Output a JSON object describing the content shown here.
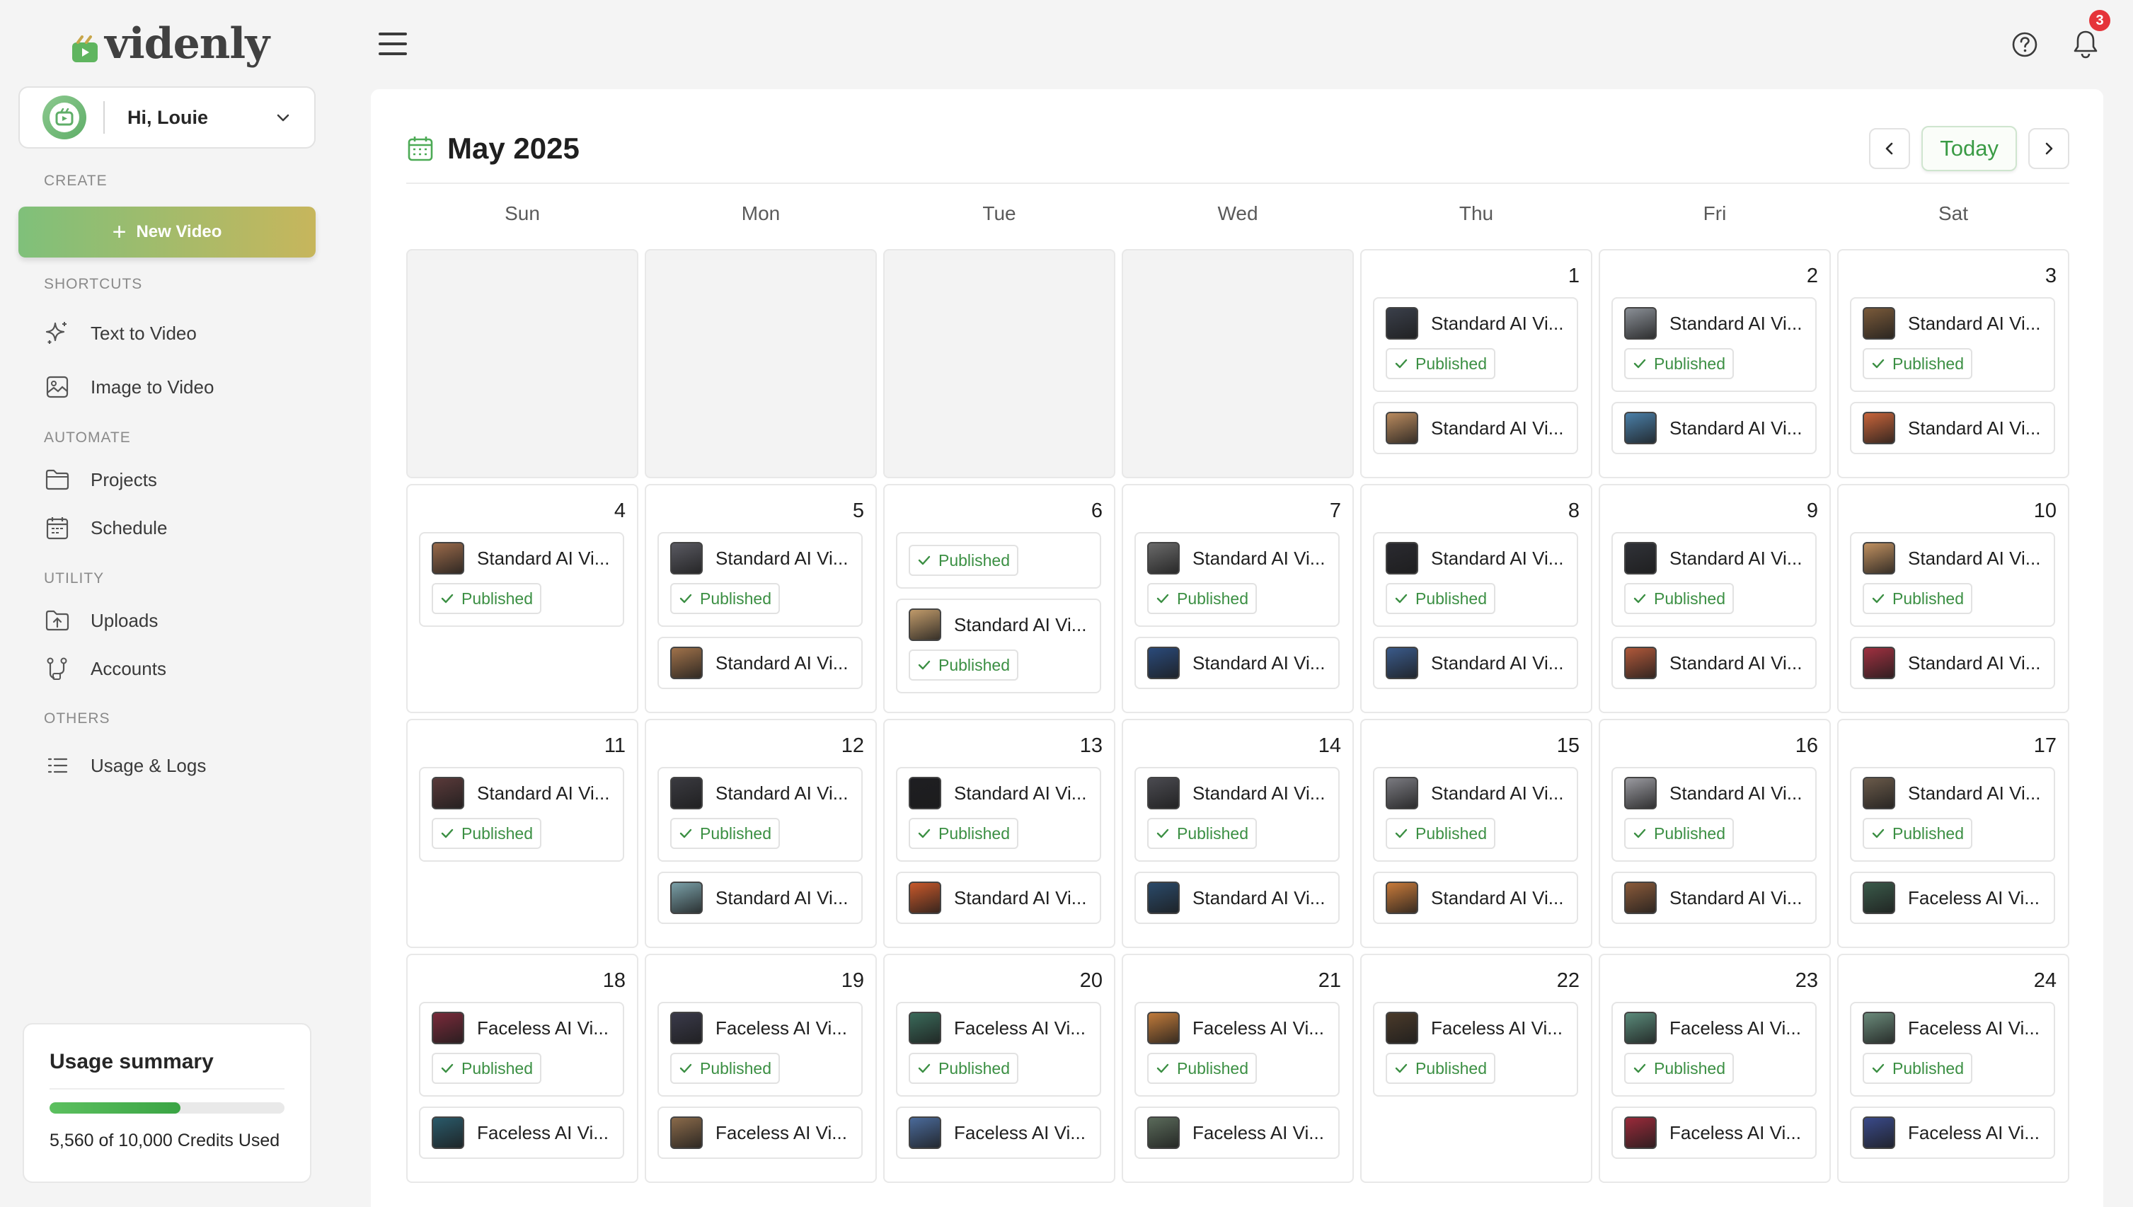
{
  "app": {
    "name": "videnly"
  },
  "user": {
    "greeting": "Hi, Louie"
  },
  "sidebar": {
    "sections": {
      "create": "CREATE",
      "shortcuts": "SHORTCUTS",
      "automate": "AUTOMATE",
      "utility": "UTILITY",
      "others": "OTHERS"
    },
    "new_video": "New Video",
    "items": [
      {
        "label": "Text to Video",
        "icon": "sparkle-icon"
      },
      {
        "label": "Image to Video",
        "icon": "image-icon"
      },
      {
        "label": "Projects",
        "icon": "folder-icon"
      },
      {
        "label": "Schedule",
        "icon": "calendar-icon"
      },
      {
        "label": "Uploads",
        "icon": "upload-icon"
      },
      {
        "label": "Accounts",
        "icon": "accounts-icon"
      },
      {
        "label": "Usage & Logs",
        "icon": "list-icon"
      }
    ]
  },
  "usage": {
    "title": "Usage summary",
    "used": 5560,
    "total": 10000,
    "text": "5,560 of 10,000 Credits Used"
  },
  "notifications": {
    "count": "3"
  },
  "calendar": {
    "title": "May 2025",
    "today_label": "Today",
    "weekdays": [
      "Sun",
      "Mon",
      "Tue",
      "Wed",
      "Thu",
      "Fri",
      "Sat"
    ],
    "published_label": "Published",
    "weeks": [
      [
        null,
        null,
        null,
        null,
        {
          "day": "1",
          "events": [
            {
              "title": "Standard AI Vi...",
              "status": "Published",
              "thumb": "#3a3f4a"
            },
            {
              "title": "Standard AI Vi...",
              "status": "",
              "thumb": "#b98a5e"
            }
          ]
        },
        {
          "day": "2",
          "events": [
            {
              "title": "Standard AI Vi...",
              "status": "Published",
              "thumb": "#8a8f96"
            },
            {
              "title": "Standard AI Vi...",
              "status": "",
              "thumb": "#4a7fa8"
            }
          ]
        },
        {
          "day": "3",
          "events": [
            {
              "title": "Standard AI Vi...",
              "status": "Published",
              "thumb": "#7a5a3a"
            },
            {
              "title": "Standard AI Vi...",
              "status": "",
              "thumb": "#c8643a"
            }
          ]
        }
      ],
      [
        {
          "day": "4",
          "events": [
            {
              "title": "Standard AI Vi...",
              "status": "Published",
              "thumb": "#9a6a4a"
            }
          ]
        },
        {
          "day": "5",
          "events": [
            {
              "title": "Standard AI Vi...",
              "status": "Published",
              "thumb": "#5a5a62"
            },
            {
              "title": "Standard AI Vi...",
              "status": "",
              "thumb": "#a0724a"
            }
          ]
        },
        {
          "day": "6",
          "events": [
            {
              "title": "",
              "status": "Published",
              "thumb": ""
            },
            {
              "title": "Standard AI Vi...",
              "status": "Published",
              "thumb": "#c09a6a"
            }
          ]
        },
        {
          "day": "7",
          "events": [
            {
              "title": "Standard AI Vi...",
              "status": "Published",
              "thumb": "#6a6a6a"
            },
            {
              "title": "Standard AI Vi...",
              "status": "",
              "thumb": "#2a4a7a"
            }
          ]
        },
        {
          "day": "8",
          "events": [
            {
              "title": "Standard AI Vi...",
              "status": "Published",
              "thumb": "#2a2a30"
            },
            {
              "title": "Standard AI Vi...",
              "status": "",
              "thumb": "#3a5a8a"
            }
          ]
        },
        {
          "day": "9",
          "events": [
            {
              "title": "Standard AI Vi...",
              "status": "Published",
              "thumb": "#303238"
            },
            {
              "title": "Standard AI Vi...",
              "status": "",
              "thumb": "#b0583a"
            }
          ]
        },
        {
          "day": "10",
          "events": [
            {
              "title": "Standard AI Vi...",
              "status": "Published",
              "thumb": "#c09060"
            },
            {
              "title": "Standard AI Vi...",
              "status": "",
              "thumb": "#a03040"
            }
          ]
        }
      ],
      [
        {
          "day": "11",
          "events": [
            {
              "title": "Standard AI Vi...",
              "status": "Published",
              "thumb": "#5a3a3a"
            }
          ]
        },
        {
          "day": "12",
          "events": [
            {
              "title": "Standard AI Vi...",
              "status": "Published",
              "thumb": "#3a3a40"
            },
            {
              "title": "Standard AI Vi...",
              "status": "",
              "thumb": "#7aa0a8"
            }
          ]
        },
        {
          "day": "13",
          "events": [
            {
              "title": "Standard AI Vi...",
              "status": "Published",
              "thumb": "#1e1e22"
            },
            {
              "title": "Standard AI Vi...",
              "status": "",
              "thumb": "#c8582a"
            }
          ]
        },
        {
          "day": "14",
          "events": [
            {
              "title": "Standard AI Vi...",
              "status": "Published",
              "thumb": "#4a4a50"
            },
            {
              "title": "Standard AI Vi...",
              "status": "",
              "thumb": "#2a4a6a"
            }
          ]
        },
        {
          "day": "15",
          "events": [
            {
              "title": "Standard AI Vi...",
              "status": "Published",
              "thumb": "#7a7a80"
            },
            {
              "title": "Standard AI Vi...",
              "status": "",
              "thumb": "#c87a3a"
            }
          ]
        },
        {
          "day": "16",
          "events": [
            {
              "title": "Standard AI Vi...",
              "status": "Published",
              "thumb": "#9a9aa0"
            },
            {
              "title": "Standard AI Vi...",
              "status": "",
              "thumb": "#8a5a3a"
            }
          ]
        },
        {
          "day": "17",
          "events": [
            {
              "title": "Standard AI Vi...",
              "status": "Published",
              "thumb": "#6a5a4a"
            },
            {
              "title": "Faceless AI Vi...",
              "status": "",
              "thumb": "#3a5a4a"
            }
          ]
        }
      ],
      [
        {
          "day": "18",
          "events": [
            {
              "title": "Faceless AI Vi...",
              "status": "Published",
              "thumb": "#7a2a3a"
            },
            {
              "title": "Faceless AI Vi...",
              "status": "",
              "thumb": "#2a5a6a"
            }
          ]
        },
        {
          "day": "19",
          "events": [
            {
              "title": "Faceless AI Vi...",
              "status": "Published",
              "thumb": "#3a3a4a"
            },
            {
              "title": "Faceless AI Vi...",
              "status": "",
              "thumb": "#8a6a4a"
            }
          ]
        },
        {
          "day": "20",
          "events": [
            {
              "title": "Faceless AI Vi...",
              "status": "Published",
              "thumb": "#3a6a5a"
            },
            {
              "title": "Faceless AI Vi...",
              "status": "",
              "thumb": "#4a6a9a"
            }
          ]
        },
        {
          "day": "21",
          "events": [
            {
              "title": "Faceless AI Vi...",
              "status": "Published",
              "thumb": "#c07a3a"
            },
            {
              "title": "Faceless AI Vi...",
              "status": "",
              "thumb": "#5a6a5a"
            }
          ]
        },
        {
          "day": "22",
          "events": [
            {
              "title": "Faceless AI Vi...",
              "status": "Published",
              "thumb": "#4a3a2a"
            }
          ]
        },
        {
          "day": "23",
          "events": [
            {
              "title": "Faceless AI Vi...",
              "status": "Published",
              "thumb": "#5a8a7a"
            },
            {
              "title": "Faceless AI Vi...",
              "status": "",
              "thumb": "#9a2a3a"
            }
          ]
        },
        {
          "day": "24",
          "events": [
            {
              "title": "Faceless AI Vi...",
              "status": "Published",
              "thumb": "#6a8a7a"
            },
            {
              "title": "Faceless AI Vi...",
              "status": "",
              "thumb": "#3a4a8a"
            }
          ]
        }
      ]
    ]
  }
}
